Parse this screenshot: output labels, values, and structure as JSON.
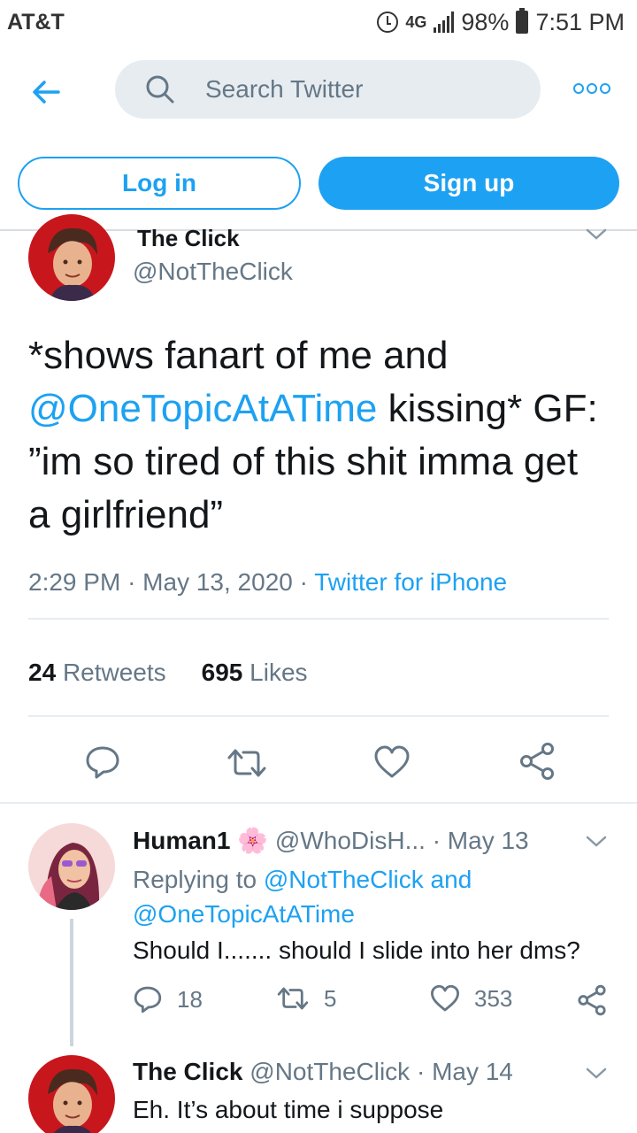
{
  "status": {
    "carrier": "AT&T",
    "network": "4G",
    "battery": "98%",
    "time": "7:51 PM"
  },
  "header": {
    "search_placeholder": "Search Twitter"
  },
  "auth": {
    "login_label": "Log in",
    "signup_label": "Sign up"
  },
  "tweet": {
    "display_name": "The Click",
    "handle": "@NotTheClick",
    "text_part1": "*shows fanart of me and ",
    "mention": "@OneTopicAtATime",
    "text_part2": " kissing* GF: ”im so tired of this shit imma get a girlfriend”",
    "time": "2:29 PM",
    "date": "May 13, 2020",
    "source": "Twitter for iPhone",
    "retweets_count": "24",
    "retweets_label": "Retweets",
    "likes_count": "695",
    "likes_label": "Likes"
  },
  "replies": [
    {
      "display_name": "Human1",
      "emoji": "🌸",
      "handle": "@WhoDisH...",
      "date": "May 13",
      "replying_prefix": "Replying to ",
      "replying_to": "@NotTheClick and @OneTopicAtATime",
      "text": "Should I....... should I slide into her dms?",
      "reply_count": "18",
      "retweet_count": "5",
      "like_count": "353"
    },
    {
      "display_name": "The Click",
      "handle": "@NotTheClick",
      "date": "May 14",
      "text": "Eh. It’s about time i suppose"
    }
  ],
  "colors": {
    "accent": "#1da1f2",
    "muted": "#657786",
    "text": "#14171a"
  }
}
